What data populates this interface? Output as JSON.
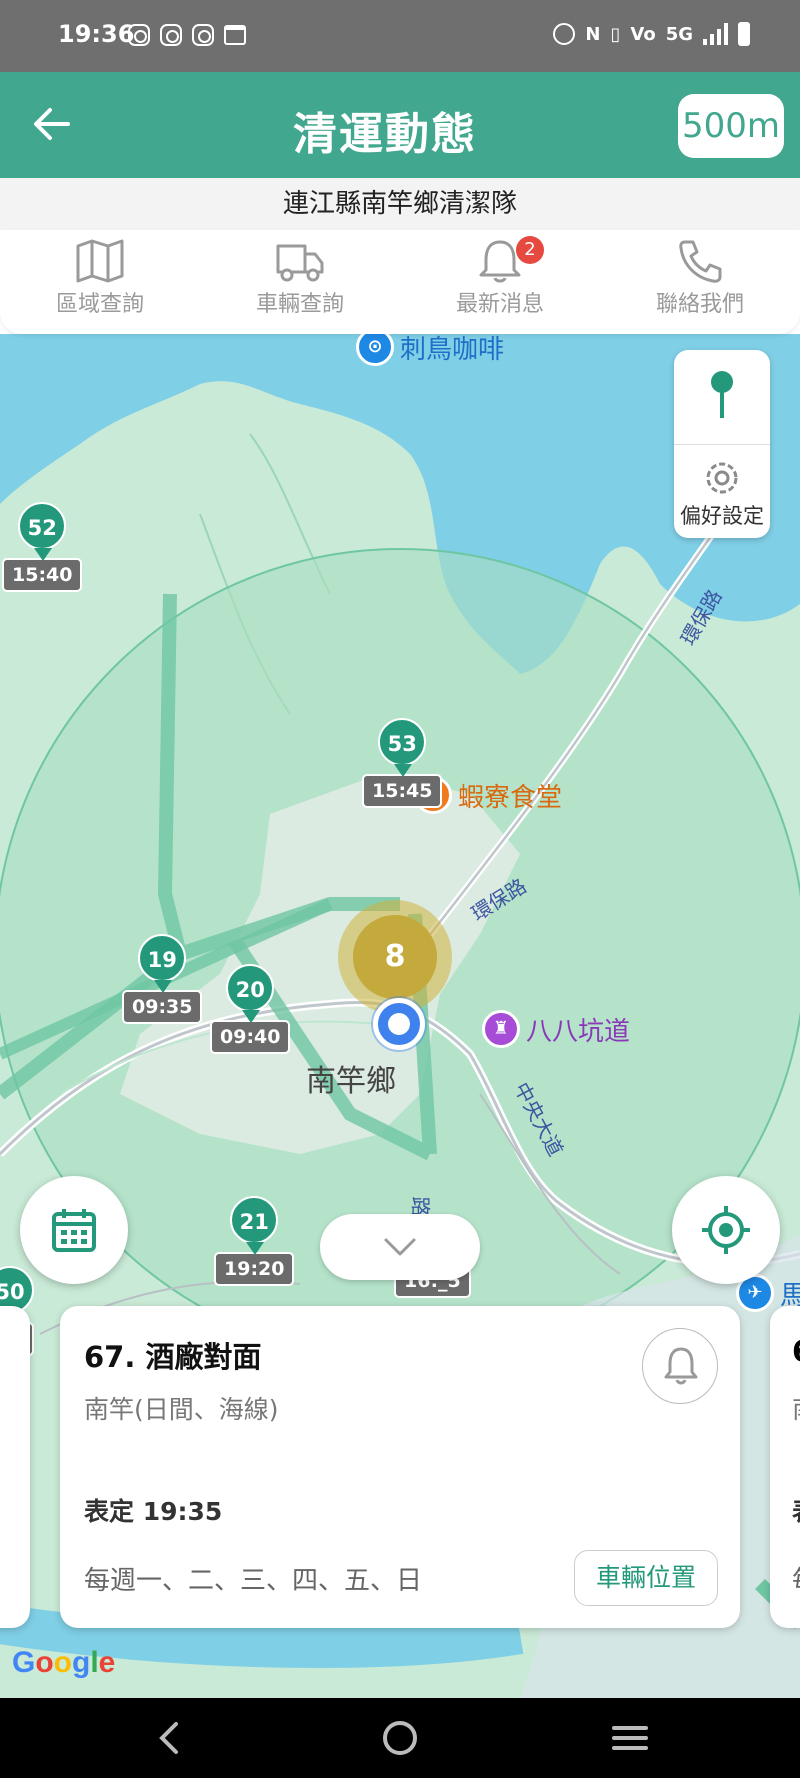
{
  "status_bar": {
    "time": "19:36",
    "network": "5G"
  },
  "header": {
    "title": "清運動態",
    "radius": "500m"
  },
  "subheader": "連江縣南竿鄉清潔隊",
  "tabs": [
    {
      "label": "區域查詢",
      "icon": "map-icon"
    },
    {
      "label": "車輛查詢",
      "icon": "truck-icon"
    },
    {
      "label": "最新消息",
      "icon": "bell-icon",
      "badge": "2"
    },
    {
      "label": "聯絡我們",
      "icon": "phone-icon"
    }
  ],
  "map": {
    "controls": {
      "preferences_label": "偏好設定"
    },
    "town": "南竿鄉",
    "pois": [
      {
        "name": "刺鳥咖啡",
        "color": "#1e88e5"
      },
      {
        "name": "蝦寮食堂",
        "color": "#f07a1e"
      },
      {
        "name": "八八坑道",
        "color": "#a64cd6"
      },
      {
        "name": "馬",
        "color": "#1e88e5"
      }
    ],
    "roads": [
      "環保路",
      "環保路",
      "中央大道",
      "路"
    ],
    "stops": [
      {
        "num": "52",
        "time": "15:40"
      },
      {
        "num": "53",
        "time": "15:45"
      },
      {
        "num": "19",
        "time": "09:35"
      },
      {
        "num": "20",
        "time": "09:40"
      },
      {
        "num": "21",
        "time": "19:20"
      },
      {
        "num": "50",
        "time": "0"
      },
      {
        "num": "",
        "time": "16:_5"
      }
    ],
    "cluster_count": "8",
    "attribution": "Google"
  },
  "card": {
    "stop_name": "67. 酒廠對面",
    "route": "南竿(日間、海線)",
    "schedule": "表定 19:35",
    "days": "每週一、二、三、四、五、日",
    "vehicle_button": "車輛位置"
  },
  "card_peek_right": {
    "stop_prefix": "6",
    "route_prefix": "南",
    "schedule_prefix": "表",
    "days_prefix": "每"
  },
  "colors": {
    "primary": "#42a78f",
    "pin": "#24987b",
    "cluster": "#c4a93c"
  }
}
